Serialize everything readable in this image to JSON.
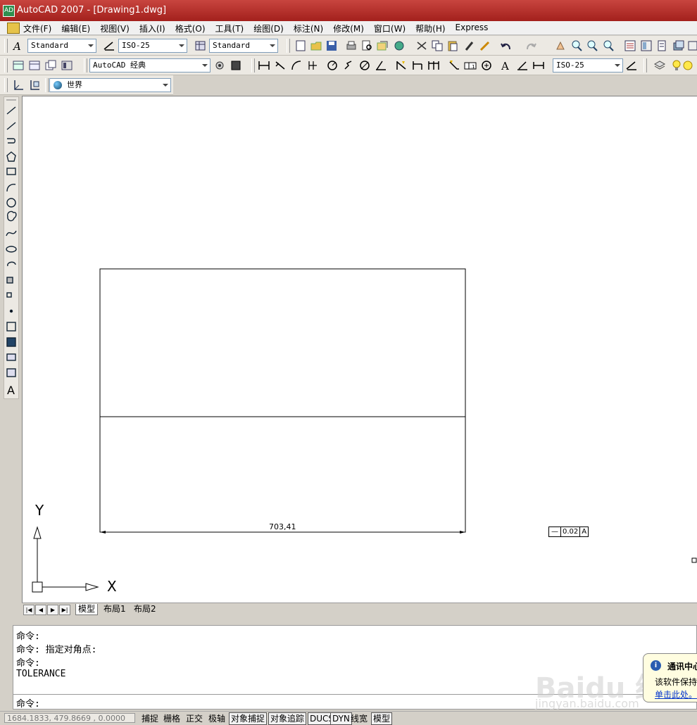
{
  "app": {
    "title": "AutoCAD 2007 - [Drawing1.dwg]",
    "icon_text": "AD"
  },
  "menu": {
    "items": [
      "文件(F)",
      "编辑(E)",
      "视图(V)",
      "插入(I)",
      "格式(O)",
      "工具(T)",
      "绘图(D)",
      "标注(N)",
      "修改(M)",
      "窗口(W)",
      "帮助(H)",
      "Express"
    ]
  },
  "toolbar1": {
    "text_style": "Standard",
    "dim_style": "ISO-25",
    "table_style": "Standard"
  },
  "toolbar2": {
    "workspace": "AutoCAD 经典",
    "dim_style2": "ISO-25"
  },
  "toolbar3": {
    "ucs": "世界"
  },
  "drawing": {
    "dimension_text": "703,41",
    "tolerance": {
      "symbol": "—",
      "value": "0.02",
      "datum": "A"
    },
    "axis_x": "X",
    "axis_y": "Y"
  },
  "tabs": {
    "model": "模型",
    "layout1": "布局1",
    "layout2": "布局2"
  },
  "command": {
    "history": [
      "命令:",
      "命令: 指定对角点:",
      "命令:",
      "TOLERANCE"
    ],
    "prompt": "命令:"
  },
  "balloon": {
    "title": "通讯中心",
    "line": "该软件保持最新",
    "link": "单击此处。"
  },
  "status": {
    "coords": "1684.1833, 479.8669 , 0.0000",
    "buttons": [
      "捕捉",
      "栅格",
      "正交",
      "极轴",
      "对象捕捉",
      "对象追踪",
      "DUCS",
      "DYN",
      "线宽",
      "模型"
    ]
  },
  "watermark": {
    "logo": "Baidu 经验",
    "url": "jingyan.baidu.com"
  },
  "colors": {
    "titlebar": "#b3302b",
    "canvas": "#ffffff",
    "link": "#0033cc"
  }
}
